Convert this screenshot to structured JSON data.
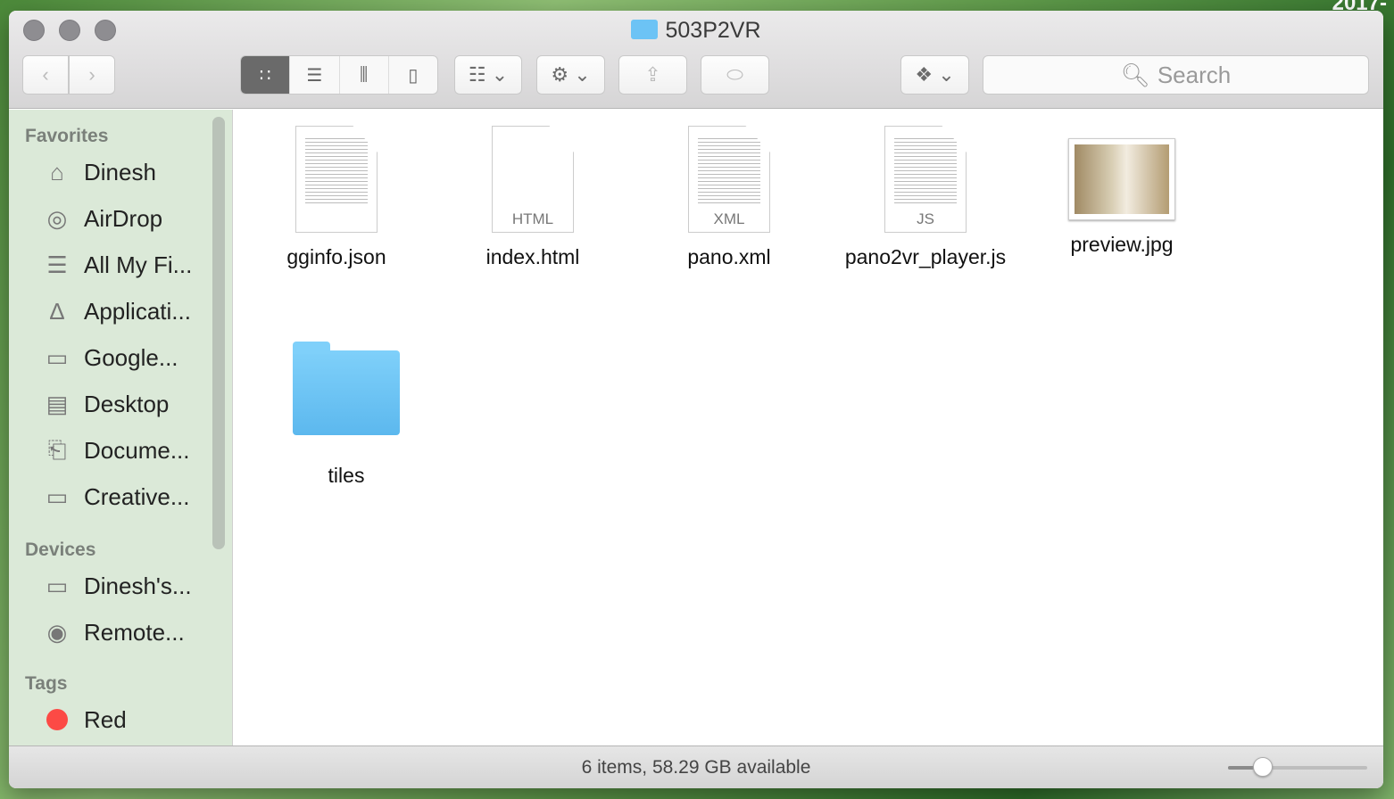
{
  "desktop": {
    "corner_text": "2017-"
  },
  "window": {
    "title": "503P2VR"
  },
  "toolbar": {
    "back_icon": "chevron-left-icon",
    "forward_icon": "chevron-right-icon",
    "view_modes": [
      "icon",
      "list",
      "column",
      "cover-flow"
    ],
    "active_view": "icon",
    "search_placeholder": "Search"
  },
  "sidebar": {
    "favorites_label": "Favorites",
    "favorites": [
      {
        "label": "Dinesh",
        "icon": "home-icon"
      },
      {
        "label": "AirDrop",
        "icon": "airdrop-icon"
      },
      {
        "label": "All My Fi...",
        "icon": "all-files-icon"
      },
      {
        "label": "Applicati...",
        "icon": "applications-icon"
      },
      {
        "label": "Google...",
        "icon": "folder-icon"
      },
      {
        "label": "Desktop",
        "icon": "desktop-icon"
      },
      {
        "label": "Docume...",
        "icon": "documents-icon"
      },
      {
        "label": "Creative...",
        "icon": "folder-icon"
      }
    ],
    "devices_label": "Devices",
    "devices": [
      {
        "label": "Dinesh's...",
        "icon": "laptop-icon"
      },
      {
        "label": "Remote...",
        "icon": "disc-icon"
      }
    ],
    "tags_label": "Tags",
    "tags": [
      {
        "label": "Red",
        "color": "#fc4a45"
      }
    ]
  },
  "files": [
    {
      "name": "gginfo.json",
      "ext": ""
    },
    {
      "name": "index.html",
      "ext": "HTML"
    },
    {
      "name": "pano.xml",
      "ext": "XML"
    },
    {
      "name": "pano2vr_player.js",
      "ext": "JS"
    },
    {
      "name": "preview.jpg",
      "ext": ""
    },
    {
      "name": "tiles",
      "ext": ""
    }
  ],
  "status": {
    "text": "6 items, 58.29 GB available",
    "icon_size_fraction": 0.25
  }
}
